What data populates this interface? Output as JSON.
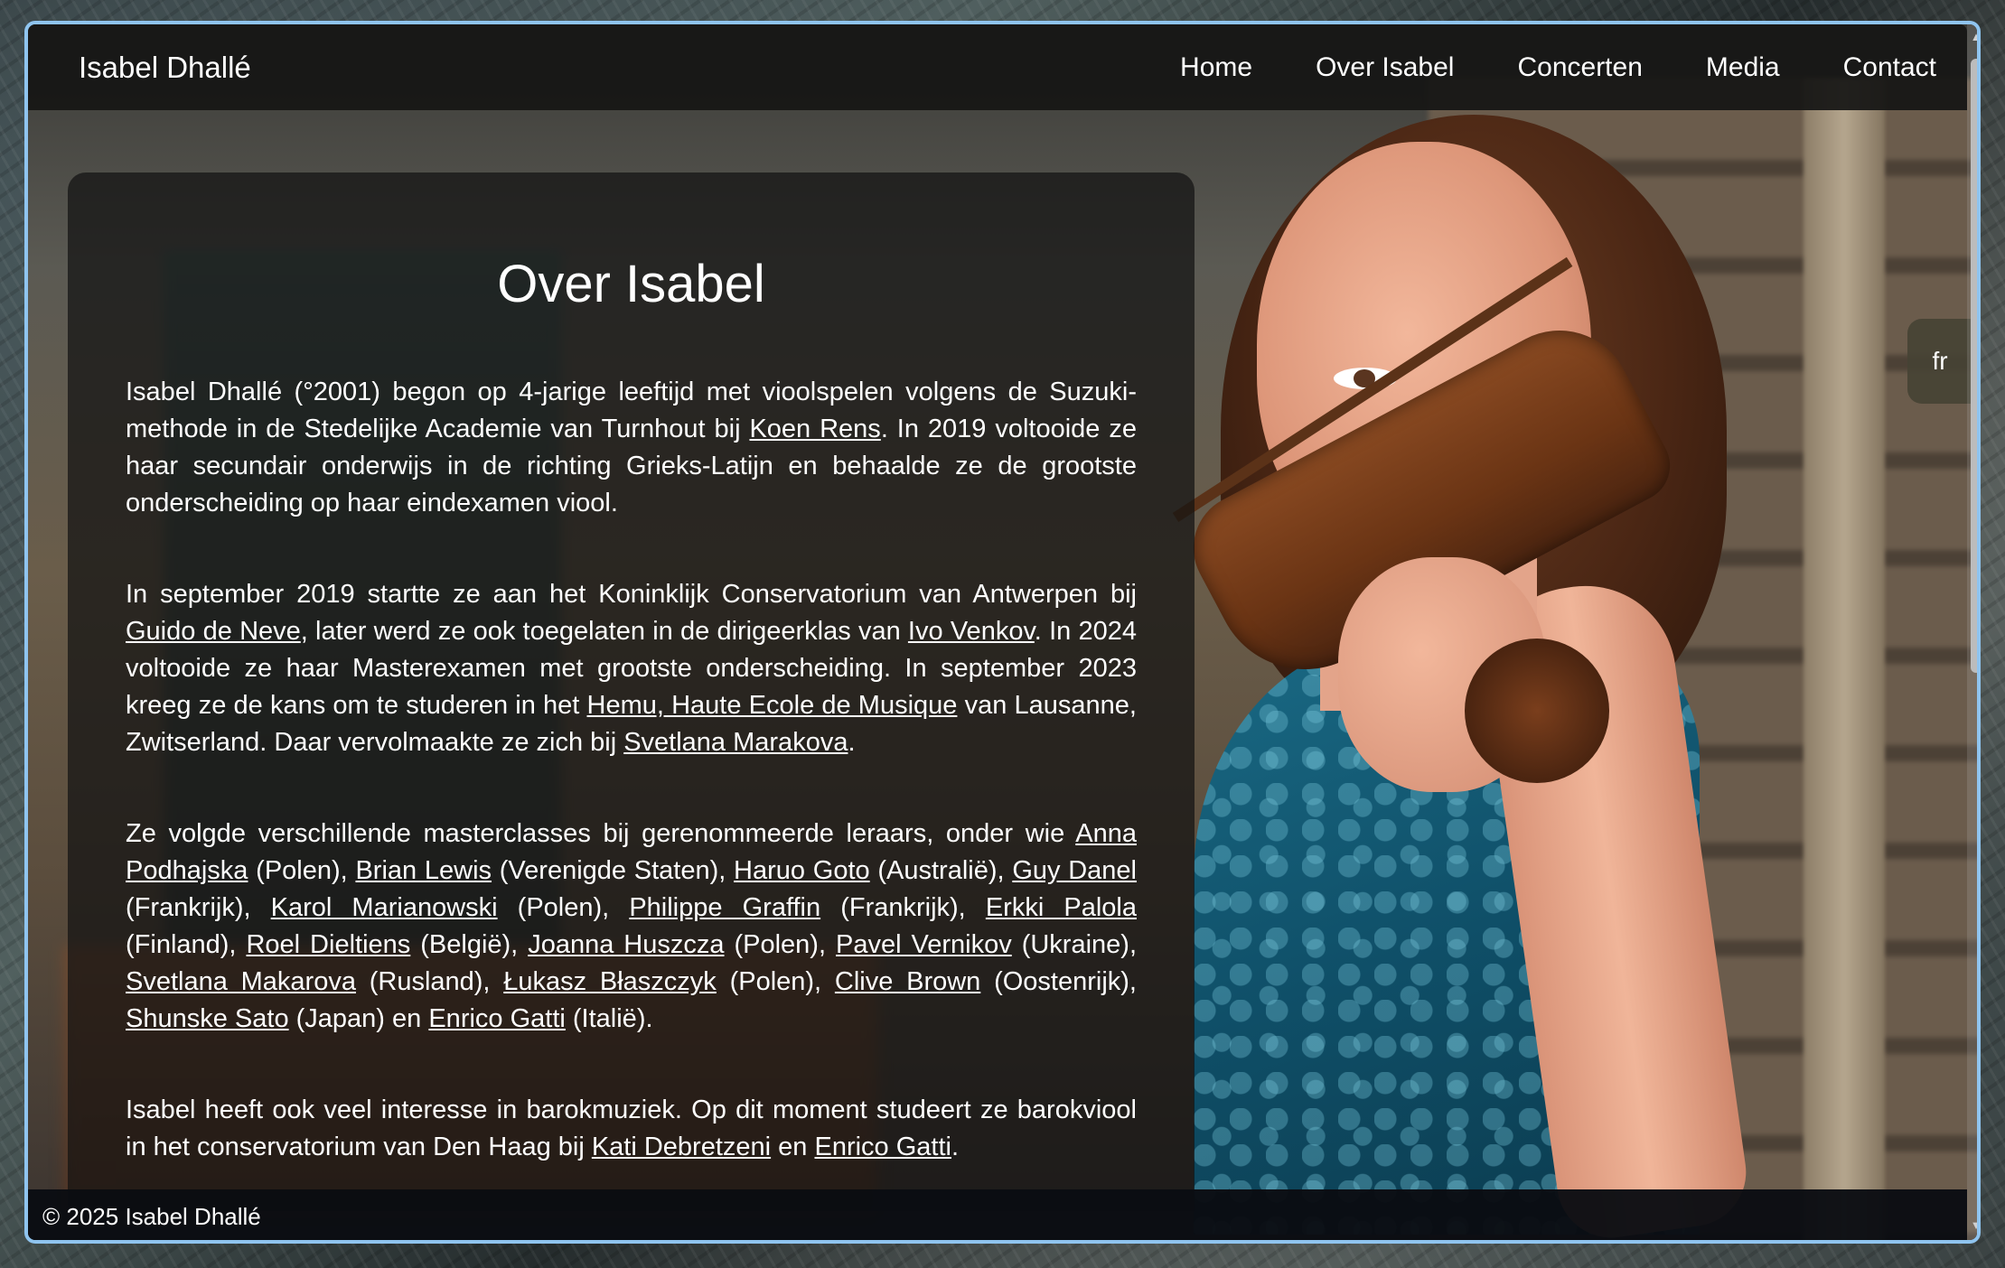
{
  "header": {
    "brand": "Isabel Dhallé",
    "nav": [
      "Home",
      "Over Isabel",
      "Concerten",
      "Media",
      "Contact"
    ]
  },
  "main": {
    "title": "Over Isabel",
    "paragraphs": [
      [
        {
          "t": "Isabel Dhallé (°2001) begon op 4-jarige leeftijd met vioolspelen volgens de Suzuki-methode in de Stedelijke Academie van Turnhout bij "
        },
        {
          "t": "Koen Rens",
          "link": true
        },
        {
          "t": ". In 2019 voltooide ze haar secundair onderwijs in de richting Grieks-Latijn en behaalde ze de grootste onderscheiding op haar eindexamen viool."
        }
      ],
      [
        {
          "t": "In september 2019 startte ze aan het Koninklijk Conservatorium van Antwerpen bij "
        },
        {
          "t": "Guido de Neve",
          "link": true
        },
        {
          "t": ", later werd ze ook toegelaten in de dirigeerklas van "
        },
        {
          "t": "Ivo Venkov",
          "link": true
        },
        {
          "t": ". In 2024 voltooide ze haar Masterexamen met grootste onderscheiding. In september 2023 kreeg ze de kans om te studeren in het "
        },
        {
          "t": "Hemu, Haute Ecole de Musique",
          "link": true
        },
        {
          "t": " van Lausanne, Zwitserland. Daar vervolmaakte ze zich bij "
        },
        {
          "t": "Svetlana Marakova",
          "link": true
        },
        {
          "t": "."
        }
      ],
      [
        {
          "t": "Ze volgde verschillende masterclasses bij gerenommeerde leraars, onder wie "
        },
        {
          "t": "Anna Podhajska",
          "link": true
        },
        {
          "t": " (Polen), "
        },
        {
          "t": "Brian Lewis",
          "link": true
        },
        {
          "t": " (Verenigde Staten), "
        },
        {
          "t": "Haruo Goto",
          "link": true
        },
        {
          "t": " (Australië), "
        },
        {
          "t": "Guy Danel",
          "link": true
        },
        {
          "t": " (Frankrijk), "
        },
        {
          "t": "Karol Marianowski",
          "link": true
        },
        {
          "t": " (Polen), "
        },
        {
          "t": "Philippe Graffin",
          "link": true
        },
        {
          "t": " (Frankrijk), "
        },
        {
          "t": "Erkki Palola",
          "link": true
        },
        {
          "t": " (Finland), "
        },
        {
          "t": "Roel Dieltiens",
          "link": true
        },
        {
          "t": " (België), "
        },
        {
          "t": "Joanna Huszcza",
          "link": true
        },
        {
          "t": " (Polen), "
        },
        {
          "t": "Pavel Vernikov",
          "link": true
        },
        {
          "t": " (Ukraine), "
        },
        {
          "t": "Svetlana Makarova",
          "link": true
        },
        {
          "t": " (Rusland), "
        },
        {
          "t": "Łukasz Błaszczyk",
          "link": true
        },
        {
          "t": " (Polen), "
        },
        {
          "t": "Clive Brown",
          "link": true
        },
        {
          "t": " (Oostenrijk), "
        },
        {
          "t": "Shunske Sato",
          "link": true
        },
        {
          "t": " (Japan) en "
        },
        {
          "t": "Enrico Gatti",
          "link": true
        },
        {
          "t": " (Italië)."
        }
      ],
      [
        {
          "t": "Isabel heeft ook veel interesse in barokmuziek. Op dit moment studeert ze barokviool in het conservatorium van Den Haag bij "
        },
        {
          "t": "Kati Debretzeni",
          "link": true
        },
        {
          "t": " en "
        },
        {
          "t": "Enrico Gatti",
          "link": true
        },
        {
          "t": "."
        }
      ]
    ]
  },
  "language_toggle": "fr",
  "footer": {
    "copyright": "© 2025 Isabel Dhallé"
  },
  "icons": {
    "scroll_up": "scroll-up-arrow-icon",
    "scroll_down": "scroll-down-arrow-icon"
  },
  "colors": {
    "window_border": "#8fc4ef",
    "navbar_bg": "#161514",
    "footer_bg": "#0a0c12",
    "text": "#ffffff"
  }
}
